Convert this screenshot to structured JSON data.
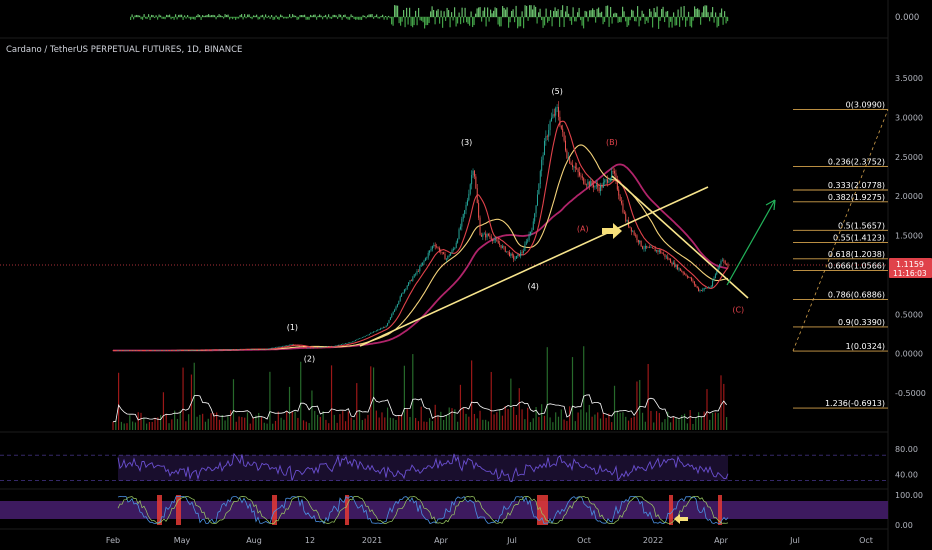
{
  "symbol_title": "Cardano / TetherUS PERPETUAL FUTURES, 1D, BINANCE",
  "top_indicator_value": "0.000",
  "price_last": "1.1159",
  "price_countdown": "11:16:03",
  "colors": {
    "background": "#000000",
    "up": "#26a69a",
    "down": "#ef5350",
    "fib_line": "#d4a24c",
    "trendline": "#f7e48c",
    "elliott_label": "#ffffff",
    "abc_label": "#e0424a",
    "ma_red": "#e0424a",
    "ma_magenta": "#b0246a",
    "ma_yellow": "#f3d27a",
    "rsi": "#6a4fd0",
    "stoch_bg": "#3d1a5f",
    "projection": "#22b35a",
    "price_tag": "#e0424a"
  },
  "chart_data": {
    "type": "line",
    "x_axis": {
      "ticks": [
        "Feb",
        "May",
        "Aug",
        "12",
        "2021",
        "Apr",
        "Jul",
        "Oct",
        "2022",
        "Apr",
        "Jul",
        "Oct"
      ]
    },
    "y_axis": {
      "ticks": [
        "3.5000",
        "3.0000",
        "2.5000",
        "2.0000",
        "1.5000",
        "1.0000",
        "0.5000",
        "0.0000",
        "-0.5000"
      ],
      "range": [
        -0.75,
        3.6
      ]
    },
    "price_series": {
      "name": "",
      "points": [
        {
          "t": 0,
          "v": 0.04
        },
        {
          "t": 3,
          "v": 0.04
        },
        {
          "t": 6,
          "v": 0.05
        },
        {
          "t": 9,
          "v": 0.06
        },
        {
          "t": 10.5,
          "v": 0.12
        },
        {
          "t": 11.3,
          "v": 0.07
        },
        {
          "t": 12,
          "v": 0.08
        },
        {
          "t": 13,
          "v": 0.1
        },
        {
          "t": 14,
          "v": 0.15
        },
        {
          "t": 15,
          "v": 0.25
        },
        {
          "t": 16,
          "v": 0.35
        },
        {
          "t": 17,
          "v": 0.8
        },
        {
          "t": 18,
          "v": 1.1
        },
        {
          "t": 18.8,
          "v": 1.4
        },
        {
          "t": 19.5,
          "v": 1.2
        },
        {
          "t": 20,
          "v": 1.35
        },
        {
          "t": 20.7,
          "v": 1.9
        },
        {
          "t": 21.1,
          "v": 2.4
        },
        {
          "t": 21.5,
          "v": 1.5
        },
        {
          "t": 22,
          "v": 1.5
        },
        {
          "t": 22.8,
          "v": 1.35
        },
        {
          "t": 23.5,
          "v": 1.2
        },
        {
          "t": 24,
          "v": 1.3
        },
        {
          "t": 24.6,
          "v": 1.65
        },
        {
          "t": 25.2,
          "v": 2.6
        },
        {
          "t": 25.6,
          "v": 2.95
        },
        {
          "t": 26,
          "v": 3.1
        },
        {
          "t": 26.6,
          "v": 2.5
        },
        {
          "t": 27.5,
          "v": 2.2
        },
        {
          "t": 28.5,
          "v": 2.1
        },
        {
          "t": 29.3,
          "v": 2.3
        },
        {
          "t": 30,
          "v": 1.7
        },
        {
          "t": 31,
          "v": 1.35
        },
        {
          "t": 32,
          "v": 1.3
        },
        {
          "t": 33,
          "v": 1.1
        },
        {
          "t": 33.8,
          "v": 0.95
        },
        {
          "t": 34.3,
          "v": 0.8
        },
        {
          "t": 35,
          "v": 0.85
        },
        {
          "t": 35.6,
          "v": 1.2
        },
        {
          "t": 36,
          "v": 1.1159
        }
      ]
    },
    "fib_levels": [
      {
        "label": "0(3.0990)",
        "value": 3.099
      },
      {
        "label": "0.236(2.3752)",
        "value": 2.3752
      },
      {
        "label": "0.333(2.0778)",
        "value": 2.0778
      },
      {
        "label": "0.382(1.9275)",
        "value": 1.9275
      },
      {
        "label": "0.5(1.5657)",
        "value": 1.5657
      },
      {
        "label": "0.55(1.4123)",
        "value": 1.4123
      },
      {
        "label": "0.618(1.2038)",
        "value": 1.2038
      },
      {
        "label": "0.666(1.0566)",
        "value": 1.0566
      },
      {
        "label": "0.786(0.6886)",
        "value": 0.6886
      },
      {
        "label": "0.9(0.3390)",
        "value": 0.339
      },
      {
        "label": "1(0.0324)",
        "value": 0.0324
      },
      {
        "label": "1.236(-0.6913)",
        "value": -0.6913
      }
    ],
    "wave_labels": [
      {
        "label": "(1)",
        "t": 10.5,
        "v": 0.3,
        "color": "elliott"
      },
      {
        "label": "(2)",
        "t": 11.5,
        "v": -0.1,
        "color": "elliott"
      },
      {
        "label": "(3)",
        "t": 20.7,
        "v": 2.65,
        "color": "elliott"
      },
      {
        "label": "(4)",
        "t": 24.6,
        "v": 0.82,
        "color": "elliott"
      },
      {
        "label": "(5)",
        "t": 26,
        "v": 3.3,
        "color": "elliott"
      },
      {
        "label": "(A)",
        "t": 27.5,
        "v": 1.55,
        "color": "abc"
      },
      {
        "label": "(B)",
        "t": 29.2,
        "v": 2.65,
        "color": "abc"
      },
      {
        "label": "(C)",
        "t": 36.6,
        "v": 0.52,
        "color": "abc"
      }
    ],
    "oscillators": {
      "rsi_ticks": [
        "80.00",
        "40.00"
      ],
      "stoch_ticks": [
        "100.00",
        "0.00"
      ]
    }
  }
}
